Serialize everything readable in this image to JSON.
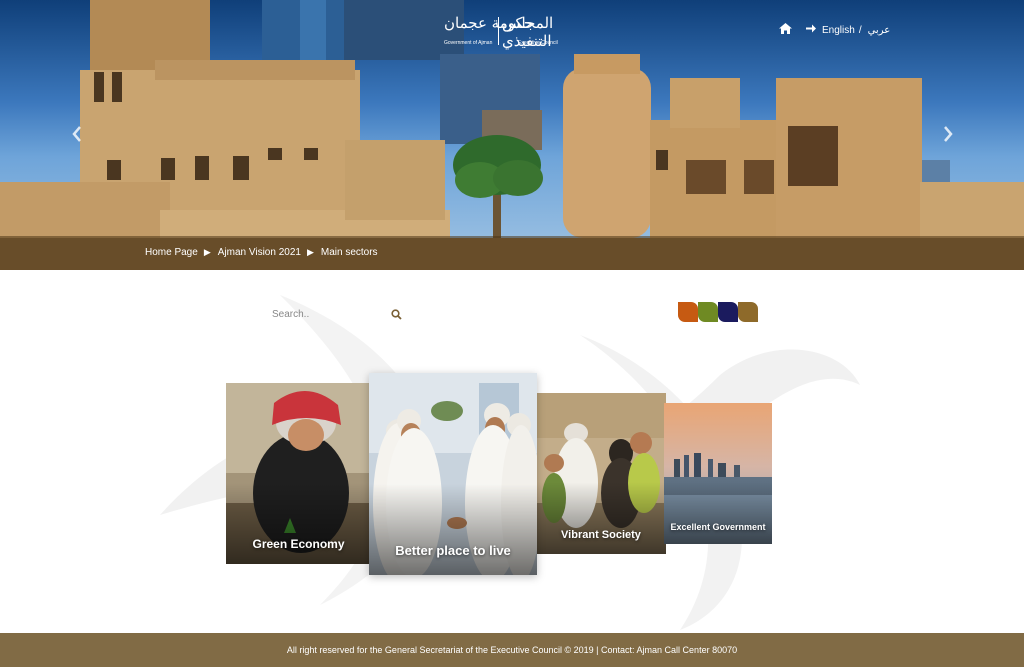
{
  "header": {
    "logo": {
      "arabic_left": "حكومة عجمان",
      "english_left": "Government of Ajman",
      "arabic_right": "المجلس التنفيذي",
      "english_right": "Executive Council"
    },
    "nav": {
      "home_icon": "home-icon",
      "arrow_icon": "arrow-right-icon",
      "english_label": "English",
      "separator": "/",
      "arabic_label": "عربي"
    }
  },
  "breadcrumb": {
    "items": [
      "Home Page",
      "Ajman Vision 2021",
      "Main sectors"
    ],
    "separator": "▶"
  },
  "search": {
    "placeholder": "Search..",
    "icon": "search-icon"
  },
  "theme_swatches": {
    "colors": [
      "#c65a12",
      "#6f8a23",
      "#1b1b5e",
      "#8e6a2a"
    ]
  },
  "sectors": [
    {
      "label": "Green Economy"
    },
    {
      "label": "Better place to live"
    },
    {
      "label": "Vibrant Society"
    },
    {
      "label": "Excellent Government"
    }
  ],
  "footer": {
    "text": "All right reserved for the General Secretariat of the Executive Council © 2019 | Contact: Ajman Call Center 80070"
  },
  "colors": {
    "footer_bg": "#816b45",
    "breadcrumb_bg": "#4c3416"
  }
}
